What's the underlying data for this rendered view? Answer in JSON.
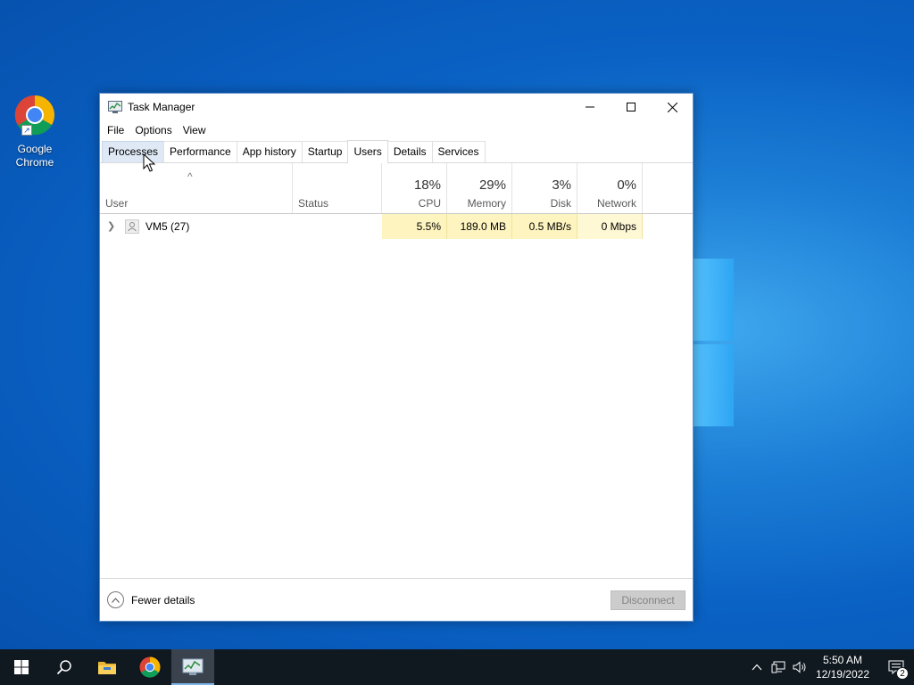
{
  "desktop": {
    "icons": [
      {
        "label": "Google Chrome"
      }
    ]
  },
  "window": {
    "title": "Task Manager",
    "menu": [
      "File",
      "Options",
      "View"
    ],
    "tabs": [
      "Processes",
      "Performance",
      "App history",
      "Startup",
      "Users",
      "Details",
      "Services"
    ],
    "active_tab": "Users",
    "hover_tab": "Processes",
    "columns": {
      "user": "User",
      "status": "Status",
      "cpu": {
        "pct": "18%",
        "name": "CPU"
      },
      "memory": {
        "pct": "29%",
        "name": "Memory"
      },
      "disk": {
        "pct": "3%",
        "name": "Disk"
      },
      "network": {
        "pct": "0%",
        "name": "Network"
      }
    },
    "rows": [
      {
        "user": "VM5 (27)",
        "status": "",
        "cpu": "5.5%",
        "memory": "189.0 MB",
        "disk": "0.5 MB/s",
        "network": "0 Mbps"
      }
    ],
    "footer": {
      "fewer_details": "Fewer details",
      "disconnect": "Disconnect"
    }
  },
  "taskbar": {
    "items": [
      "start-icon",
      "search-icon",
      "file-explorer-icon",
      "chrome-icon",
      "task-manager-icon"
    ],
    "active_item": "task-manager-icon",
    "clock": {
      "time": "5:50 AM",
      "date": "12/19/2022"
    },
    "notification_count": "2"
  },
  "colors": {
    "accent": "#0a62c4",
    "cpu_heat": "#fdf4bf",
    "taskbar": "#101820"
  }
}
